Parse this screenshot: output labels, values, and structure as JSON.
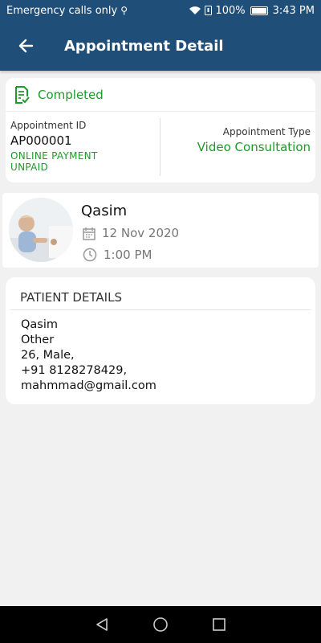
{
  "status_bar": {
    "carrier_text": "Emergency calls only",
    "battery_percent": "100%",
    "time": "3:43 PM"
  },
  "app_bar": {
    "title": "Appointment Detail"
  },
  "appointment": {
    "status": "Completed",
    "id_label": "Appointment ID",
    "id_value": "AP000001",
    "payment_method": "ONLINE PAYMENT",
    "payment_status": "UNPAID",
    "type_label": "Appointment Type",
    "type_value": "Video Consultation"
  },
  "doctor": {
    "name": "Qasim",
    "date": "12 Nov 2020",
    "time": "1:00 PM"
  },
  "patient": {
    "header": "PATIENT DETAILS",
    "lines": [
      "Qasim",
      "Other",
      "26, Male,",
      "+91 8128278429,",
      "mahmmad@gmail.com"
    ]
  },
  "colors": {
    "primary": "#1f4e79",
    "success": "#1e9a2a",
    "background": "#f1f1f1"
  }
}
